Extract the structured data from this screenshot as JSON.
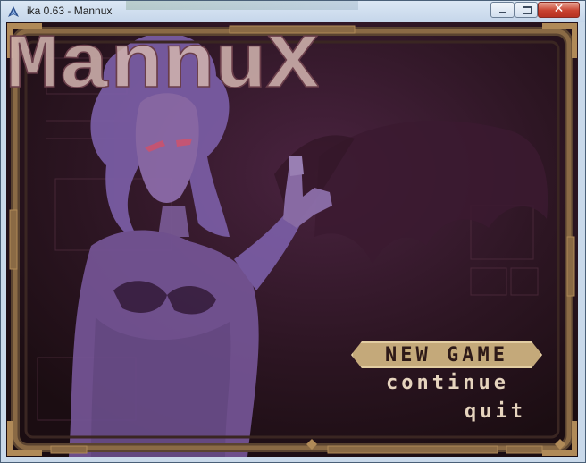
{
  "window": {
    "title": "ika 0.63 - Mannux",
    "close_glyph": "✕"
  },
  "game": {
    "logo_text": "MannuX",
    "menu": {
      "new_game": "NEW GAME",
      "continue": "continue",
      "quit": "quit",
      "selected": "NEW GAME"
    }
  },
  "colors": {
    "frame": "#8a6a45",
    "frame_inner": "#3a2622",
    "background": "#251319",
    "character": "#7a5a9e",
    "logo": "#cfb2ad",
    "menu_highlight": "#c4a97a",
    "menu_text": "#e6d4be"
  }
}
